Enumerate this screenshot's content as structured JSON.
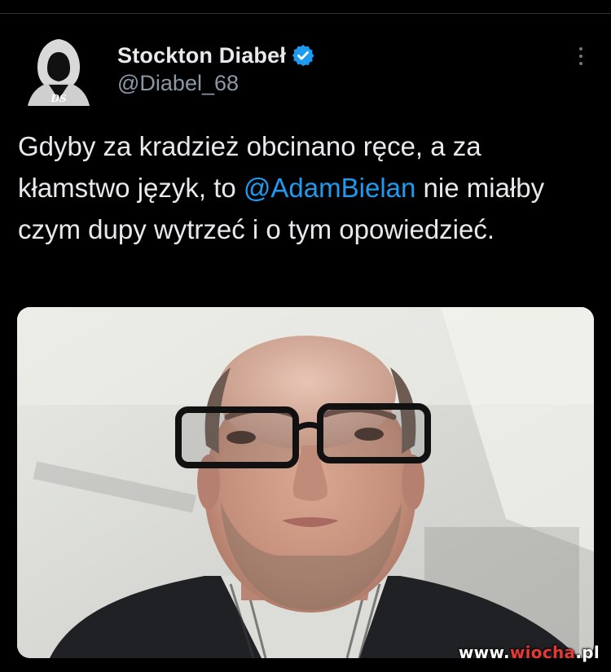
{
  "author": {
    "display_name": "Stockton Diabeł",
    "handle": "@Diabel_68",
    "avatar_icon": "hooded-figure-avatar-icon",
    "avatar_monogram": "DS",
    "verified": true,
    "verified_color": "#1d9bf0"
  },
  "tweet": {
    "text_before": "Gdyby za kradzież obcinano ręce, a za kłamstwo język, to ",
    "mention": "@AdamBielan",
    "text_after": " nie miałby czym dupy wytrzeć i o tym opowiedzieć.",
    "mention_color": "#1d9bf0"
  },
  "media": {
    "description_icon": "portrait-photo"
  },
  "menu": {
    "icon": "more-vertical-icon"
  },
  "watermark": {
    "prefix": "www.",
    "accent": "wiocha",
    "suffix": ".pl"
  },
  "colors": {
    "background": "#000000",
    "text": "#e7e9ea",
    "secondary": "#8b98a5"
  }
}
